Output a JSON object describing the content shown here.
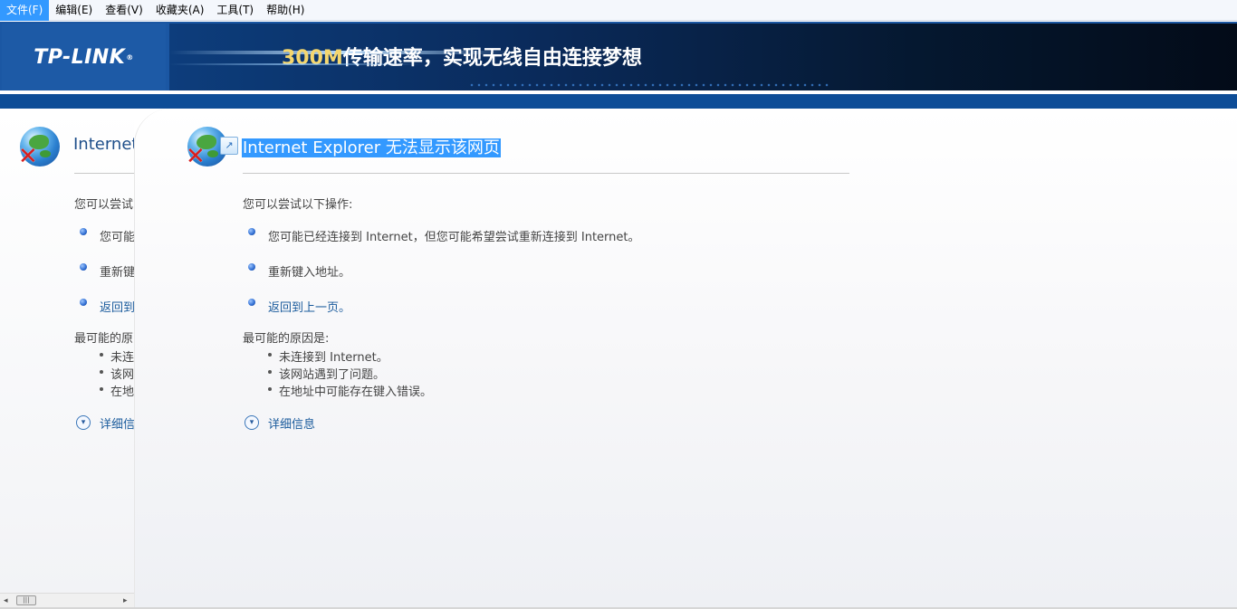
{
  "menubar": {
    "items": [
      "文件(F)",
      "编辑(E)",
      "查看(V)",
      "收藏夹(A)",
      "工具(T)",
      "帮助(H)"
    ],
    "active_index": 0
  },
  "banner": {
    "logo": "TP-LINK",
    "logo_reg": "®",
    "slogan_number": "300M",
    "slogan_text": "传输速率，实现无线自由连接梦想"
  },
  "left_frame": {
    "title": "Internet",
    "lines": [
      "您可以尝试",
      "您可能",
      "重新键",
      "返回到",
      "最可能的原",
      "未连",
      "该网",
      "在地",
      "详细信"
    ]
  },
  "main": {
    "title": "Internet Explorer 无法显示该网页",
    "try_header": "您可以尝试以下操作:",
    "actions": [
      {
        "text": "您可能已经连接到 Internet，但您可能希望尝试重新连接到 Internet。",
        "link": false
      },
      {
        "text": "重新键入地址。",
        "link": false
      },
      {
        "text": "返回到上一页。",
        "link": true
      }
    ],
    "cause_header": "最可能的原因是:",
    "causes": [
      "未连接到 Internet。",
      "该网站遇到了问题。",
      "在地址中可能存在键入错误。"
    ],
    "details_link": "详细信息"
  },
  "colors": {
    "menu_active": "#3399ff",
    "banner_blue": "#1b57a3",
    "link": "#1a5b9c",
    "selection": "#3399ff",
    "error_x": "#d81e1e"
  },
  "icons": {
    "error_globe": "ie-error-globe-icon",
    "bullet": "blue-ball-bullet-icon",
    "expand": "chevron-down-circle-icon",
    "forward": "forward-arrow-icon"
  }
}
